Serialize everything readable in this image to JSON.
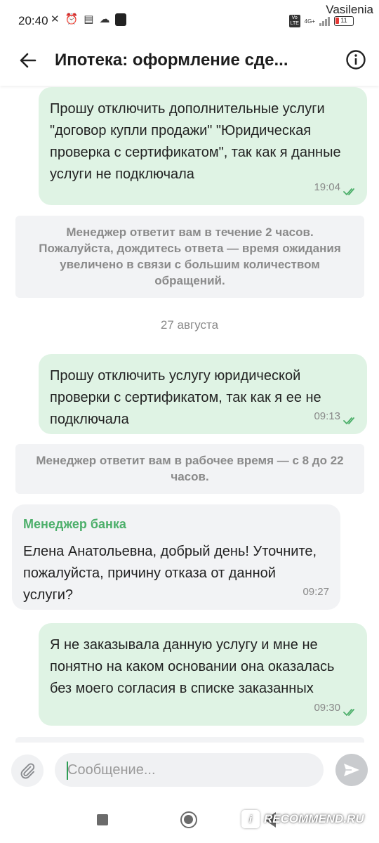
{
  "status_bar": {
    "time": "20:40",
    "network_label": "4G+",
    "volte_label": "Vo LTE",
    "battery_level": "11",
    "overlay_user": "Vasilenia"
  },
  "header": {
    "title": "Ипотека: оформление сде..."
  },
  "messages": [
    {
      "direction": "outgoing",
      "text": "Прошу отключить дополнительные услуги \"договор купли продажи\" \"Юридическая проверка с сертификатом\", так как я данные услуги не подключала",
      "time": "19:04",
      "status": "read"
    },
    {
      "type": "system",
      "text": "Менеджер ответит вам в течение 2 часов. Пожалуйста, дождитесь ответа — время ожидания увеличено в связи с большим количеством обращений."
    },
    {
      "type": "date",
      "text": "27 августа"
    },
    {
      "direction": "outgoing",
      "text": "Прошу отключить услугу юридической проверки с сертификатом, так как я ее не подключала",
      "time": "09:13",
      "status": "read"
    },
    {
      "type": "system",
      "text": "Менеджер ответит вам в рабочее время — с 8 до 22 часов."
    },
    {
      "direction": "incoming",
      "sender": "Менеджер банка",
      "text": "Елена Анатольевна, добрый день! Уточните, пожалуйста, причину отказа от данной услуги?",
      "time": "09:27"
    },
    {
      "direction": "outgoing",
      "text": "Я не заказывала данную услугу и мне не понятно на каком основании она оказалась без моего согласия в списке заказанных",
      "time": "09:30",
      "status": "read"
    }
  ],
  "composer": {
    "placeholder": "Сообщение..."
  },
  "watermark": {
    "badge": "i",
    "text": "RECOMMEND.RU"
  },
  "colors": {
    "outgoing_bubble": "#dff3e4",
    "incoming_bubble": "#f2f3f5",
    "sender_name": "#4caf6a",
    "read_check": "#4caf6a"
  }
}
